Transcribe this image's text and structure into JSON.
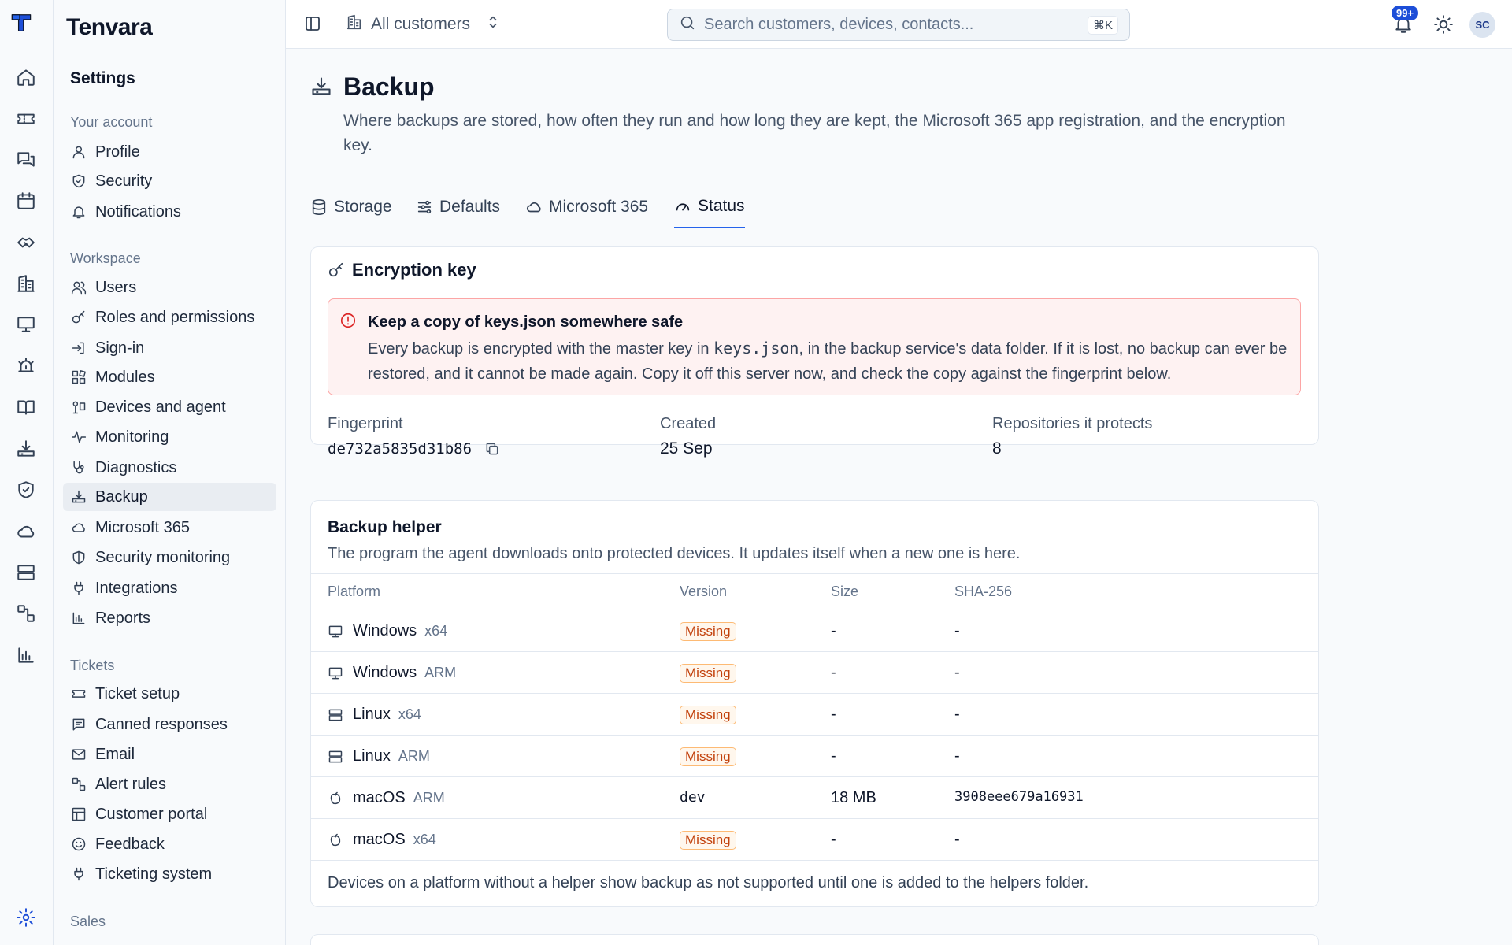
{
  "app": {
    "brand": "Tenvara"
  },
  "rail": {
    "icons": [
      "home-icon",
      "ticket-icon",
      "chat-icon",
      "calendar-icon",
      "handshake-icon",
      "building-icon",
      "monitor-icon",
      "alarm-icon",
      "book-icon",
      "backup-icon",
      "shield-icon",
      "cloud-icon",
      "server-icon",
      "workflow-icon",
      "chart-icon",
      "settings-icon"
    ]
  },
  "sidebar": {
    "title": "Settings",
    "groups": [
      {
        "label": "Your account",
        "items": [
          "Profile",
          "Security",
          "Notifications"
        ]
      },
      {
        "label": "Workspace",
        "items": [
          "Users",
          "Roles and permissions",
          "Sign-in",
          "Modules",
          "Devices and agent",
          "Monitoring",
          "Diagnostics",
          "Backup",
          "Microsoft 365",
          "Security monitoring",
          "Integrations",
          "Reports"
        ]
      },
      {
        "label": "Tickets",
        "items": [
          "Ticket setup",
          "Canned responses",
          "Email",
          "Alert rules",
          "Customer portal",
          "Feedback",
          "Ticketing system"
        ]
      },
      {
        "label": "Sales",
        "items": []
      }
    ],
    "active": "Backup"
  },
  "topbar": {
    "customer_scope": "All customers",
    "search_placeholder": "Search customers, devices, contacts...",
    "search_shortcut": "⌘K",
    "notification_count": "99+",
    "avatar_initials": "SC"
  },
  "page": {
    "title": "Backup",
    "description": "Where backups are stored, how often they run and how long they are kept, the Microsoft 365 app registration, and the encryption key.",
    "tabs": [
      {
        "label": "Storage",
        "active": false
      },
      {
        "label": "Defaults",
        "active": false
      },
      {
        "label": "Microsoft 365",
        "active": false
      },
      {
        "label": "Status",
        "active": true
      }
    ]
  },
  "encryption": {
    "title": "Encryption key",
    "alert_title": "Keep a copy of keys.json somewhere safe",
    "alert_body_1": "Every backup is encrypted with the master key in ",
    "alert_body_code": "keys.json",
    "alert_body_2": ", in the backup service's data folder. If it is lost, no backup can ever be restored, and it cannot be made again. Copy it off this server now, and check the copy against the fingerprint below.",
    "fingerprint_label": "Fingerprint",
    "fingerprint_value": "de732a5835d31b86",
    "created_label": "Created",
    "created_value": "25 Sep",
    "repos_label": "Repositories it protects",
    "repos_value": "8"
  },
  "helper": {
    "title": "Backup helper",
    "description": "The program the agent downloads onto protected devices. It updates itself when a new one is here.",
    "columns": [
      "Platform",
      "Version",
      "Size",
      "SHA-256"
    ],
    "rows": [
      {
        "platform": "Windows",
        "arch": "x64",
        "version": "Missing",
        "size": "-",
        "sha": "-"
      },
      {
        "platform": "Windows",
        "arch": "ARM",
        "version": "Missing",
        "size": "-",
        "sha": "-"
      },
      {
        "platform": "Linux",
        "arch": "x64",
        "version": "Missing",
        "size": "-",
        "sha": "-"
      },
      {
        "platform": "Linux",
        "arch": "ARM",
        "version": "Missing",
        "size": "-",
        "sha": "-"
      },
      {
        "platform": "macOS",
        "arch": "ARM",
        "version": "dev",
        "size": "18 MB",
        "sha": "3908eee679a16931"
      },
      {
        "platform": "macOS",
        "arch": "x64",
        "version": "Missing",
        "size": "-",
        "sha": "-"
      }
    ],
    "footer": "Devices on a platform without a helper show backup as not supported until one is added to the helpers folder."
  }
}
